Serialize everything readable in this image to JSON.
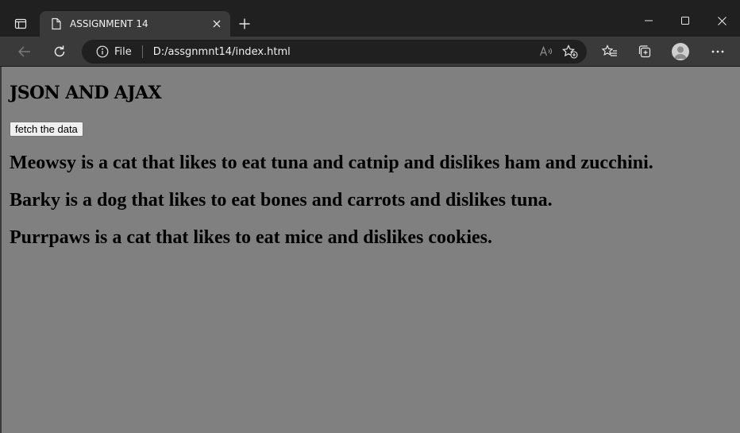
{
  "browser": {
    "tab": {
      "title": "ASSIGNMENT 14"
    },
    "address_bar": {
      "site_info_label": "File",
      "url": "D:/assgnmnt14/index.html"
    },
    "icons": {
      "tab_actions": "tab-actions-icon",
      "page": "document-icon",
      "close_tab": "close-icon",
      "new_tab": "plus-icon",
      "minimize": "minimize-icon",
      "maximize": "maximize-icon",
      "close_window": "close-icon",
      "back": "back-arrow-icon",
      "refresh": "refresh-icon",
      "info": "info-icon",
      "read_aloud": "read-aloud-icon",
      "add_favorite": "star-plus-icon",
      "favorites": "favorites-icon",
      "collections": "collections-icon",
      "profile": "profile-icon",
      "more": "more-icon"
    },
    "colors": {
      "frame": "#202020",
      "toolbar": "#3a3a3a",
      "page_background": "#808080"
    }
  },
  "page": {
    "heading": "JSON AND AJAX",
    "fetch_button_label": "fetch the data",
    "pets": [
      "Meowsy is a cat that likes to eat tuna and catnip and dislikes ham and zucchini.",
      "Barky is a dog that likes to eat bones and carrots and dislikes tuna.",
      "Purrpaws is a cat that likes to eat mice and dislikes cookies."
    ]
  }
}
